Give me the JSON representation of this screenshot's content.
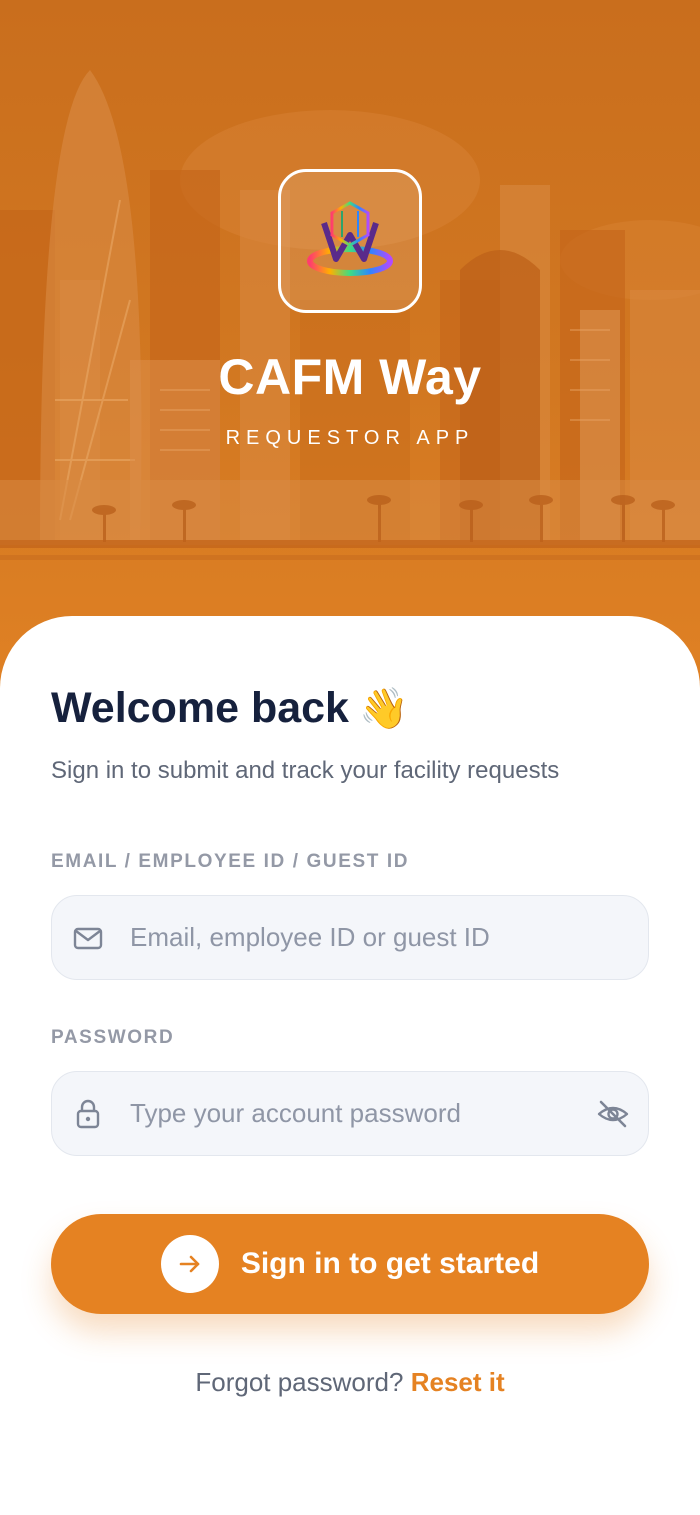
{
  "brand": {
    "app_name": "CAFM Way",
    "subtitle": "REQUESTOR APP",
    "logo_icon": "cafm-way-logo-icon",
    "accent_color": "#e58222",
    "hero_color": "#d27821"
  },
  "welcome": {
    "title": "Welcome back",
    "emoji": "👋",
    "lead": "Sign in to submit and track your facility requests"
  },
  "form": {
    "email": {
      "label": "EMAIL / EMPLOYEE ID / GUEST ID",
      "placeholder": "Email, employee ID or guest ID",
      "value": "",
      "icon": "mail-icon"
    },
    "password": {
      "label": "PASSWORD",
      "placeholder": "Type your account password",
      "value": "",
      "icon": "lock-icon",
      "toggle_icon": "eye-off-icon"
    },
    "submit": {
      "label": "Sign in to get started",
      "icon": "arrow-right-icon"
    }
  },
  "footer": {
    "forgot_text": "Forgot password?",
    "reset_link": "Reset it"
  }
}
